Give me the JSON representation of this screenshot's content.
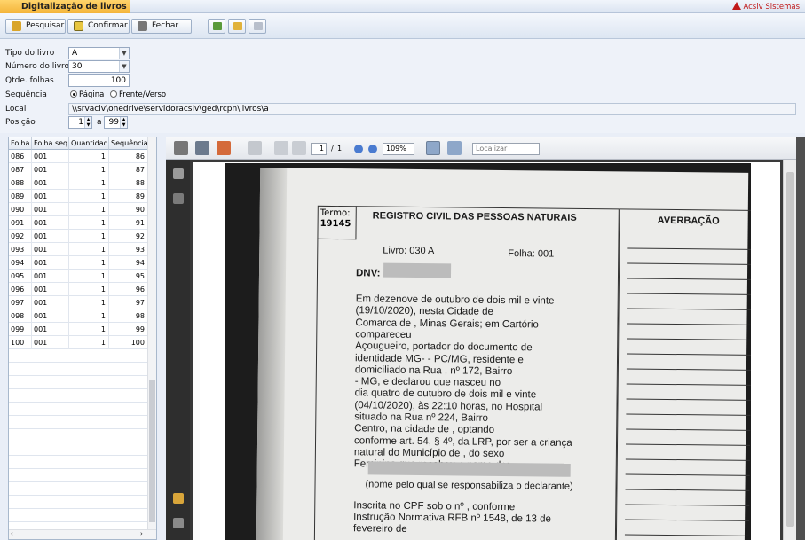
{
  "window": {
    "tab_title": "Digitalização de livros",
    "brand": "Acsiv Sistemas",
    "brand_color": "#c01818"
  },
  "toolbar": {
    "search_label": "Pesquisar",
    "confirm_label": "Confirmar",
    "close_label": "Fechar"
  },
  "form": {
    "tipo_label": "Tipo do livro",
    "tipo_value": "A",
    "numero_label": "Número do livro",
    "numero_value": "30",
    "qtde_label": "Qtde. folhas",
    "qtde_value": "100",
    "sequencia_label": "Sequência",
    "opt_pagina": "Página",
    "opt_frente": "Frente/Verso",
    "selected_option": "Página",
    "local_label": "Local",
    "local_value": "\\\\srvaciv\\onedrive\\servidoracsiv\\ged\\rcpn\\livros\\a",
    "posicao_label": "Posição",
    "pos_from": "1",
    "pos_sep": "a",
    "pos_to": "99"
  },
  "grid": {
    "columns": [
      "Folha",
      "Folha seq.",
      "Quantidade",
      "Sequência"
    ],
    "rows": [
      [
        "086",
        "001",
        "1",
        "86"
      ],
      [
        "087",
        "001",
        "1",
        "87"
      ],
      [
        "088",
        "001",
        "1",
        "88"
      ],
      [
        "089",
        "001",
        "1",
        "89"
      ],
      [
        "090",
        "001",
        "1",
        "90"
      ],
      [
        "091",
        "001",
        "1",
        "91"
      ],
      [
        "092",
        "001",
        "1",
        "92"
      ],
      [
        "093",
        "001",
        "1",
        "93"
      ],
      [
        "094",
        "001",
        "1",
        "94"
      ],
      [
        "095",
        "001",
        "1",
        "95"
      ],
      [
        "096",
        "001",
        "1",
        "96"
      ],
      [
        "097",
        "001",
        "1",
        "97"
      ],
      [
        "098",
        "001",
        "1",
        "98"
      ],
      [
        "099",
        "001",
        "1",
        "99"
      ],
      [
        "100",
        "001",
        "1",
        "100"
      ]
    ]
  },
  "viewer": {
    "page_current": "1",
    "page_sep": "/",
    "page_total": "1",
    "zoom": "109%",
    "find_placeholder": "Localizar"
  },
  "document": {
    "termo_label": "Termo:",
    "termo_number": "19145",
    "title": "REGISTRO CIVIL DAS PESSOAS NATURAIS",
    "livro": "Livro: 030 A",
    "folha": "Folha: 001",
    "dnv": "DNV:",
    "averbacao": "AVERBAÇÃO",
    "lines": [
      "Em dezenove de outubro de dois mil e vinte",
      "(19/10/2020), nesta Cidade de",
      "Comarca de               , Minas Gerais; em Cartório",
      "compareceu",
      "           Açougueiro, portador do documento de",
      "identidade MG-              - PC/MG, residente e",
      "domiciliado na Rua              , nº 172, Bairro",
      "                        - MG, e declarou que nasceu no",
      "dia quatro de outubro de dois mil e vinte",
      "(04/10/2020), às 22:10 horas, no Hospital",
      "            situado na Rua              nº 224, Bairro",
      "Centro, na cidade de                    , optando",
      "conforme art. 54, § 4º, da LRP, por ser a criança",
      "natural do Município de                  , do sexo",
      "Feminino que recebeu o nome de:"
    ],
    "responsible": "(nome pelo qual se responsabiliza o declarante)",
    "cpf_lines": [
      "Inscrita no CPF sob o nº                    , conforme",
      "Instrução Normativa RFB nº 1548, de 13 de",
      "fevereiro de"
    ]
  }
}
